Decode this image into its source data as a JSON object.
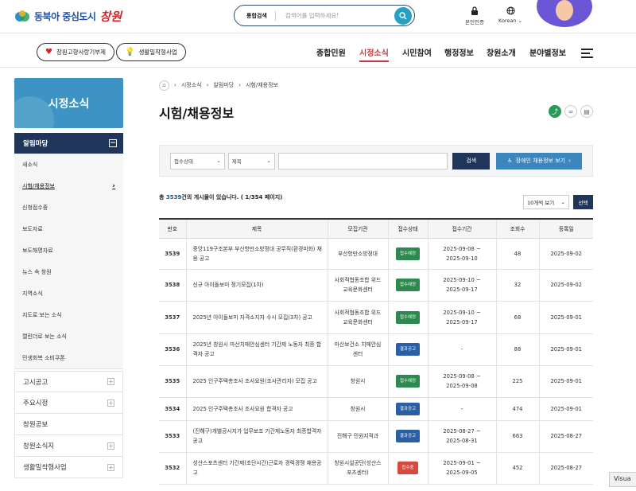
{
  "header": {
    "logo_text": "동북아 중심도시",
    "logo_script": "창원",
    "search": {
      "tag": "통합검색",
      "placeholder": "검색어를 입력하세요!"
    },
    "util": [
      {
        "label": "본인인증",
        "icon": "lock-icon"
      },
      {
        "label": "Korean ⌄",
        "icon": "globe-icon"
      }
    ]
  },
  "nav": {
    "pills": [
      {
        "label": "창원고향사랑기부제",
        "icon": "heart-icon"
      },
      {
        "label": "생활밀착형사업",
        "icon": "bulb-icon"
      }
    ],
    "menu": [
      "종합민원",
      "시정소식",
      "시민참여",
      "행정정보",
      "창원소개",
      "분야별정보"
    ],
    "active_index": 1
  },
  "sidebar": {
    "heading": "시정소식",
    "group": "알림마당",
    "items": [
      "새소식",
      "시험/채용정보",
      "신청접수중",
      "보도자료",
      "보도해명자료",
      "뉴스 속 창원",
      "지역소식",
      "지도로 보는 소식",
      "캘린더로 보는 소식",
      "민생회복 소비쿠폰"
    ],
    "current_index": 1,
    "categories": [
      "고시공고",
      "주요시정",
      "창원공보",
      "창원소식지",
      "생활밀착형사업"
    ]
  },
  "breadcrumb": [
    "시정소식",
    "알림마당",
    "시험/채용정보"
  ],
  "page_title": "시험/채용정보",
  "filter": {
    "status_select": "접수상태",
    "field_select": "제목",
    "search_button": "검색",
    "accessible_button": "장애인 채용정보 보기"
  },
  "summary": {
    "prefix": "총 ",
    "total": "3539",
    "suffix": "건의 게시물이 있습니다. ( 1/354 페이지)"
  },
  "per_page": "10개씩 보기",
  "select_button": "선택",
  "table": {
    "headers": [
      "번호",
      "제목",
      "모집기관",
      "접수상태",
      "접수기간",
      "조회수",
      "등록일"
    ],
    "rows": [
      {
        "no": "3539",
        "title": "중앙119구조본부 부산항만소방정대 공무직(환경미화) 채용 공고",
        "org": "부산항만소방정대",
        "status": "접수예정",
        "status_color": "g",
        "period": "2025-09-08 ~\n2025-09-10",
        "views": "48",
        "date": "2025-09-02"
      },
      {
        "no": "3538",
        "title": "신규 아이돌보미 정기모집(1차)",
        "org": "사회적협동조합 위드\n교육문화센터",
        "status": "접수예정",
        "status_color": "g",
        "period": "2025-09-10 ~\n2025-09-17",
        "views": "32",
        "date": "2025-09-02"
      },
      {
        "no": "3537",
        "title": "2025년 아이돌보미 자격소지자 수시 모집(3차) 공고",
        "org": "사회적협동조합 위드\n교육문화센터",
        "status": "접수예정",
        "status_color": "g",
        "period": "2025-09-10 ~\n2025-09-17",
        "views": "68",
        "date": "2025-09-01"
      },
      {
        "no": "3536",
        "title": "2025년 창원시 마산치매안심센터 기간제 노동자 최종 합격자 공고",
        "org": "마산보건소 치매안심\n센터",
        "status": "결과공고",
        "status_color": "b",
        "period": "-",
        "views": "88",
        "date": "2025-09-01"
      },
      {
        "no": "3535",
        "title": "2025 인구주택총조사 조사요원(조사관리자) 모집 공고",
        "org": "창원시",
        "status": "접수예정",
        "status_color": "g",
        "period": "2025-09-08 ~\n2025-09-08",
        "views": "225",
        "date": "2025-09-01"
      },
      {
        "no": "3534",
        "title": "2025 인구주택총조사 조사요원 합격자 공고",
        "org": "창원시",
        "status": "결과공고",
        "status_color": "b",
        "period": "-",
        "views": "474",
        "date": "2025-09-01"
      },
      {
        "no": "3533",
        "title": "(진해구)개별공시지가 업무보조 기간제노동자 최종합격자 공고",
        "org": "진해구 민원지적과",
        "status": "결과공고",
        "status_color": "b",
        "period": "2025-08-27 ~\n2025-08-31",
        "views": "663",
        "date": "2025-08-27"
      },
      {
        "no": "3532",
        "title": "성산스포츠센터 기간제(초단시간)근로자 경력경쟁 채용공고",
        "org": "창원시설공단(성산스\n포츠센터)",
        "status": "접수중",
        "status_color": "r",
        "period": "2025-09-01 ~\n2025-09-05",
        "views": "452",
        "date": "2025-08-27"
      }
    ]
  },
  "overlay": "Visua"
}
